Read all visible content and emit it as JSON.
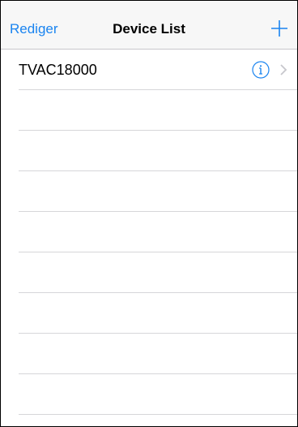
{
  "navbar": {
    "left_label": "Rediger",
    "title": "Device List",
    "add_icon": "plus-icon"
  },
  "colors": {
    "accent": "#1a84f0",
    "separator": "#d6d6d9",
    "chevron": "#c7c7cc"
  },
  "devices": [
    {
      "name": "TVAC18000",
      "info_icon": "info-circle-icon",
      "accessory_icon": "chevron-right-icon"
    }
  ]
}
